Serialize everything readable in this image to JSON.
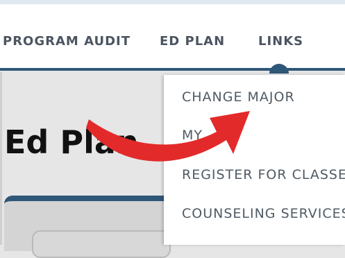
{
  "nav": {
    "tabs": [
      {
        "label": "PROGRAM AUDIT"
      },
      {
        "label": "ED PLAN"
      },
      {
        "label": "LINKS"
      }
    ]
  },
  "page": {
    "title": "Ed Plan"
  },
  "dropdown": {
    "items": [
      {
        "label": "CHANGE MAJOR"
      },
      {
        "label": "MY"
      },
      {
        "label": "REGISTER FOR CLASSES"
      },
      {
        "label": "COUNSELING SERVICES"
      }
    ]
  },
  "annotation": {
    "arrow_color": "#e32a2a"
  },
  "colors": {
    "nav_accent": "#2f5778",
    "nav_text": "#4b5560",
    "dropdown_text": "#4f5a64"
  }
}
